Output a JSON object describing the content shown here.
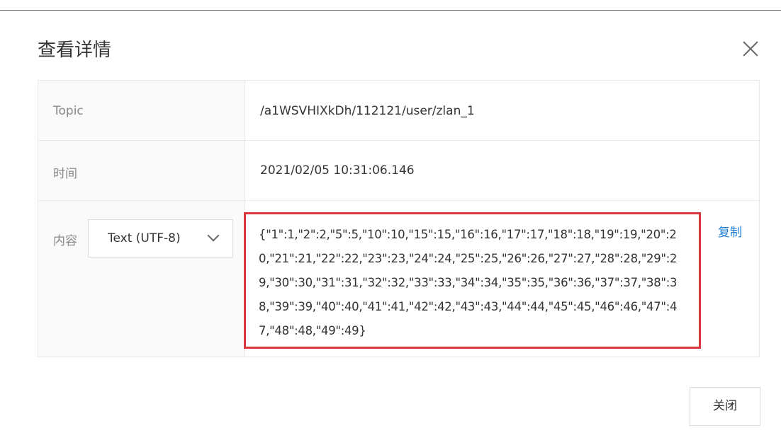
{
  "dialog": {
    "title": "查看详情",
    "close_icon": "close-icon"
  },
  "details": {
    "topic": {
      "label": "Topic",
      "value": "/a1WSVHIXkDh/112121/user/zlan_1"
    },
    "time": {
      "label": "时间",
      "value": "2021/02/05 10:31:06.146"
    },
    "content": {
      "label": "内容",
      "encoding_select": "Text (UTF-8)",
      "value": "{\"1\":1,\"2\":2,\"5\":5,\"10\":10,\"15\":15,\"16\":16,\"17\":17,\"18\":18,\"19\":19,\"20\":20,\"21\":21,\"22\":22,\"23\":23,\"24\":24,\"25\":25,\"26\":26,\"27\":27,\"28\":28,\"29\":29,\"30\":30,\"31\":31,\"32\":32,\"33\":33,\"34\":34,\"35\":35,\"36\":36,\"37\":37,\"38\":38,\"39\":39,\"40\":40,\"41\":41,\"42\":42,\"43\":43,\"44\":44,\"45\":45,\"46\":46,\"47\":47,\"48\":48,\"49\":49}",
      "copy_label": "复制",
      "highlight_color": "#d9363e"
    }
  },
  "footer": {
    "close_button_label": "关闭"
  },
  "colors": {
    "link": "#1f7fd6",
    "label": "#888888",
    "border": "#e8e8e8"
  }
}
